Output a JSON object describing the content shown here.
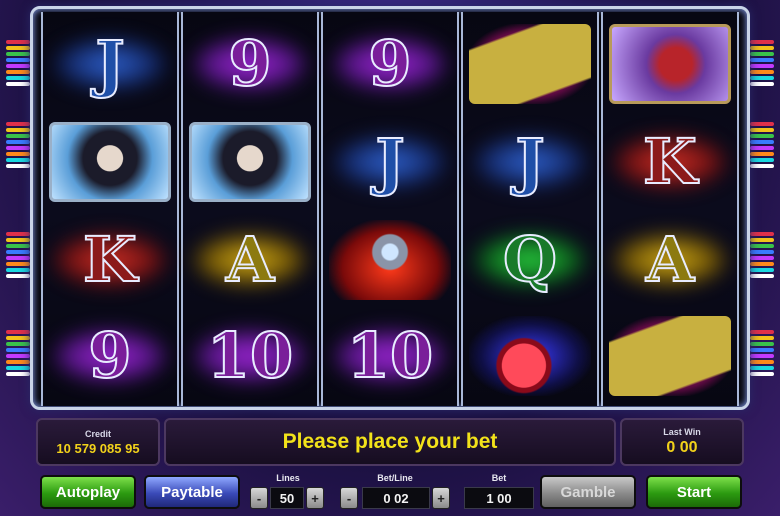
{
  "reels": [
    [
      {
        "symbol": "J",
        "kind": "letter",
        "color": "blue"
      },
      {
        "symbol": "woman",
        "kind": "picture"
      },
      {
        "symbol": "K",
        "kind": "letter",
        "color": "red"
      },
      {
        "symbol": "9",
        "kind": "letter",
        "color": "purple"
      }
    ],
    [
      {
        "symbol": "9",
        "kind": "letter",
        "color": "purple"
      },
      {
        "symbol": "woman",
        "kind": "picture"
      },
      {
        "symbol": "A",
        "kind": "letter",
        "color": "yellow"
      },
      {
        "symbol": "10",
        "kind": "letter",
        "color": "purple"
      }
    ],
    [
      {
        "symbol": "9",
        "kind": "letter",
        "color": "purple"
      },
      {
        "symbol": "J",
        "kind": "letter",
        "color": "blue"
      },
      {
        "symbol": "amulet",
        "kind": "picture"
      },
      {
        "symbol": "10",
        "kind": "letter",
        "color": "purple"
      }
    ],
    [
      {
        "symbol": "scroll",
        "kind": "picture"
      },
      {
        "symbol": "J",
        "kind": "letter",
        "color": "blue"
      },
      {
        "symbol": "Q",
        "kind": "letter",
        "color": "green"
      },
      {
        "symbol": "potion",
        "kind": "picture"
      }
    ],
    [
      {
        "symbol": "dragon",
        "kind": "picture"
      },
      {
        "symbol": "K",
        "kind": "letter",
        "color": "red"
      },
      {
        "symbol": "A",
        "kind": "letter",
        "color": "yellow"
      },
      {
        "symbol": "scroll",
        "kind": "picture"
      }
    ]
  ],
  "payline_colors": [
    "#e0304a",
    "#f2c21a",
    "#3ac24a",
    "#3a7cff",
    "#c23aff",
    "#ff8a1a",
    "#1ad8e0",
    "#ffffff"
  ],
  "credit": {
    "label": "Credit",
    "value": "10 579 085 95"
  },
  "message": "Please place your bet",
  "last_win": {
    "label": "Last Win",
    "value": "0 00"
  },
  "controls": {
    "autoplay": "Autoplay",
    "paytable": "Paytable",
    "lines_label": "Lines",
    "lines_value": "50",
    "betline_label": "Bet/Line",
    "betline_value": "0 02",
    "bet_label": "Bet",
    "bet_value": "1 00",
    "gamble": "Gamble",
    "start": "Start",
    "minus": "-",
    "plus": "+"
  }
}
